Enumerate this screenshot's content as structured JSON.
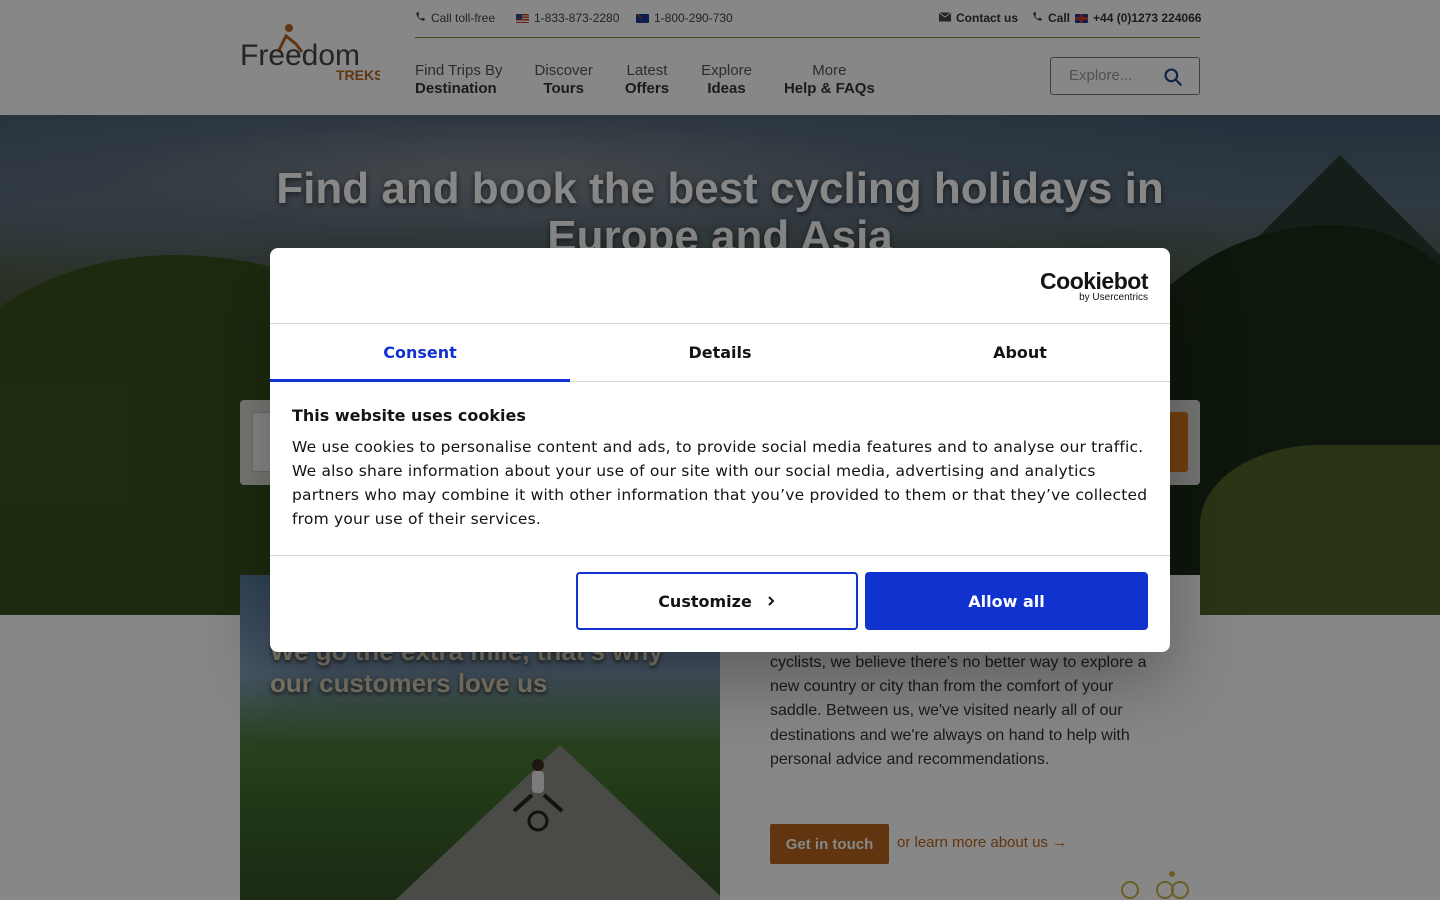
{
  "header": {
    "logo": {
      "word1": "Freedom",
      "word2": "TREKS"
    },
    "topbar": {
      "call_toll_free": "Call toll-free",
      "us_phone": "1-833-873-2280",
      "au_phone": "1-800-290-730",
      "contact_us": "Contact us",
      "call_label": "Call",
      "uk_phone": "+44 (0)1273 224066"
    },
    "nav": [
      {
        "line1": "Find Trips By",
        "line2": "Destination"
      },
      {
        "line1": "Discover",
        "line2": "Tours"
      },
      {
        "line1": "Latest",
        "line2": "Offers"
      },
      {
        "line1": "Explore",
        "line2": "Ideas"
      },
      {
        "line1": "More",
        "line2": "Help & FAQs"
      }
    ],
    "search": {
      "placeholder": "Explore..."
    }
  },
  "hero": {
    "title": "Find and book the best cycling holidays in Europe and Asia"
  },
  "promo": {
    "text": "We go the extra mile, that's why our customers love us"
  },
  "about": {
    "text": "cyclists, we believe there's no better way to explore a new country or city than from the comfort of your saddle. Between us, we've visited nearly all of our destinations and we're always on hand to help with personal advice and recommendations.",
    "cta": "Get in touch",
    "learn_more": "or learn more about us →"
  },
  "cookie_dialog": {
    "brand": "Cookiebot",
    "brand_sub": "by Usercentrics",
    "tabs": [
      {
        "label": "Consent",
        "active": true
      },
      {
        "label": "Details",
        "active": false
      },
      {
        "label": "About",
        "active": false
      }
    ],
    "title": "This website uses cookies",
    "body": "We use cookies to personalise content and ads, to provide social media features and to analyse our traffic. We also share information about your use of our site with our social media, advertising and analytics partners who may combine it with other information that you’ve provided to them or that they’ve collected from your use of their services.",
    "customize_label": "Customize",
    "allow_all_label": "Allow all"
  },
  "colors": {
    "accent_blue": "#1032cf",
    "brand_orange": "#b5651d",
    "overlay": "rgba(0,0,0,0.47)"
  },
  "icons": [
    "phone-icon",
    "flag-us-icon",
    "flag-au-icon",
    "mail-icon",
    "flag-uk-icon",
    "search-icon",
    "chevron-right-icon",
    "cyclist-icon"
  ]
}
